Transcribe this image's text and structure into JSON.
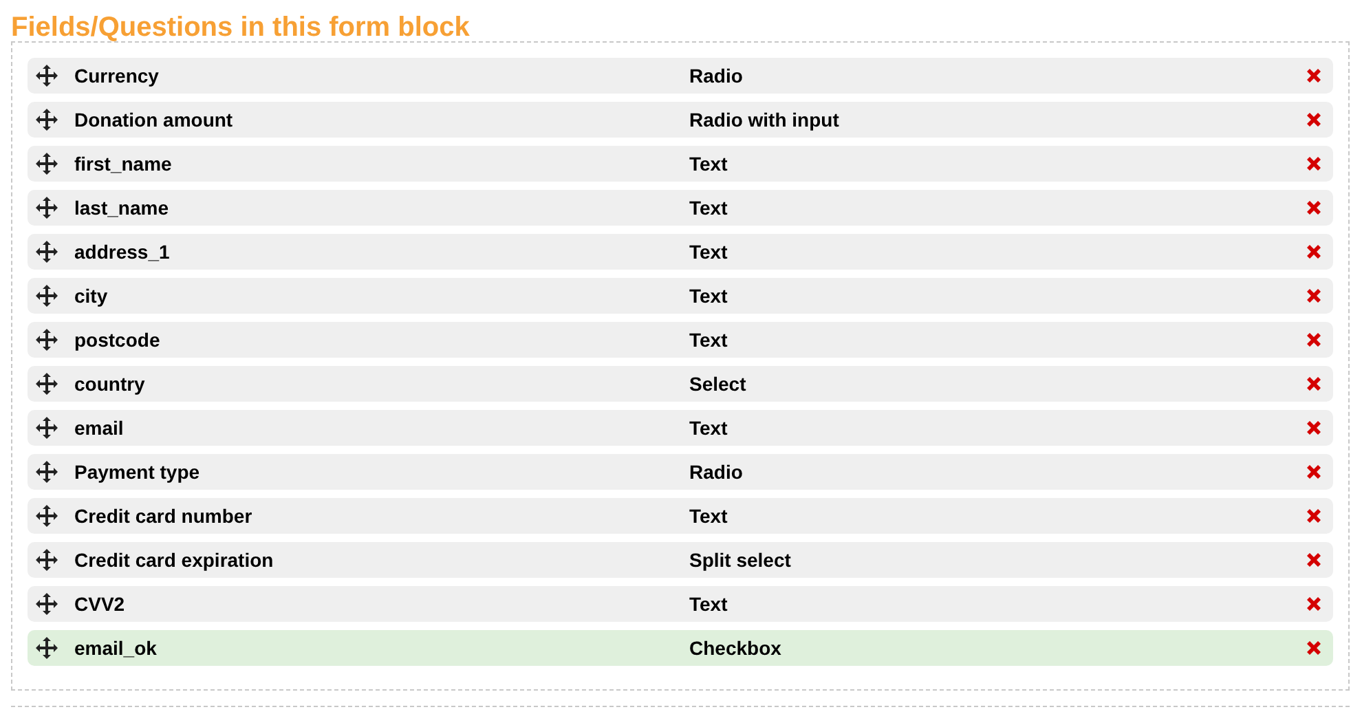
{
  "title": "Fields/Questions in this form block",
  "fields": [
    {
      "name": "Currency",
      "type": "Radio",
      "selected": false
    },
    {
      "name": "Donation amount",
      "type": "Radio with input",
      "selected": false
    },
    {
      "name": "first_name",
      "type": "Text",
      "selected": false
    },
    {
      "name": "last_name",
      "type": "Text",
      "selected": false
    },
    {
      "name": "address_1",
      "type": "Text",
      "selected": false
    },
    {
      "name": "city",
      "type": "Text",
      "selected": false
    },
    {
      "name": "postcode",
      "type": "Text",
      "selected": false
    },
    {
      "name": "country",
      "type": "Select",
      "selected": false
    },
    {
      "name": "email",
      "type": "Text",
      "selected": false
    },
    {
      "name": "Payment type",
      "type": "Radio",
      "selected": false
    },
    {
      "name": "Credit card number",
      "type": "Text",
      "selected": false
    },
    {
      "name": "Credit card expiration",
      "type": "Split select",
      "selected": false
    },
    {
      "name": "CVV2",
      "type": "Text",
      "selected": false
    },
    {
      "name": "email_ok",
      "type": "Checkbox",
      "selected": true
    }
  ]
}
